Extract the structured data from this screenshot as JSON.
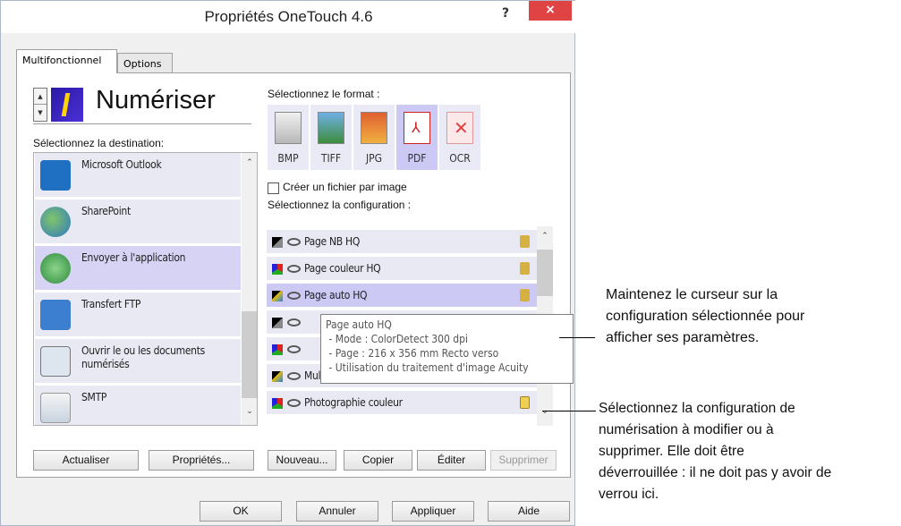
{
  "window": {
    "title": "Propriétés OneTouch 4.6",
    "help": "?",
    "close": "×"
  },
  "tabs": [
    {
      "label": "Multifonctionnel"
    },
    {
      "label": "Options"
    }
  ],
  "scan": {
    "title": "Numériser"
  },
  "destination": {
    "label": "Sélectionnez la destination:",
    "items": [
      {
        "label": "Microsoft Outlook",
        "icon": "outlook-icon"
      },
      {
        "label": "SharePoint",
        "icon": "sharepoint-icon"
      },
      {
        "label": "Envoyer à l'application",
        "icon": "send-app-icon",
        "selected": true
      },
      {
        "label": "Transfert FTP",
        "icon": "ftp-icon"
      },
      {
        "label": "Ouvrir le ou les documents\nnumérisés",
        "icon": "open-docs-icon"
      },
      {
        "label": "SMTP",
        "icon": "mail-icon"
      }
    ]
  },
  "format": {
    "label": "Sélectionnez le format :",
    "items": [
      {
        "label": "BMP",
        "icon": "bmp-icon"
      },
      {
        "label": "TIFF",
        "icon": "tiff-icon"
      },
      {
        "label": "JPG",
        "icon": "jpg-icon"
      },
      {
        "label": "PDF",
        "icon": "pdf-icon",
        "selected": true
      },
      {
        "label": "OCR",
        "icon": "ocr-icon"
      }
    ]
  },
  "one_file_per_image": {
    "label": "Créer un fichier par image",
    "checked": false
  },
  "configuration": {
    "label": "Sélectionnez la configuration :",
    "items": [
      {
        "label": "Page NB HQ"
      },
      {
        "label": "Page couleur HQ"
      },
      {
        "label": "Page auto HQ",
        "selected": true
      },
      {
        "label": ""
      },
      {
        "label": ""
      },
      {
        "label": "Multipaquets auto HQ"
      },
      {
        "label": "Photographie couleur"
      }
    ]
  },
  "tooltip": {
    "line1": "Page auto HQ",
    "line2": " - Mode : ColorDetect 300 dpi",
    "line3": " - Page : 216 x 356 mm Recto verso",
    "line4": " - Utilisation du traitement d'image Acuity"
  },
  "buttons": {
    "refresh": "Actualiser",
    "properties": "Propriétés...",
    "new": "Nouveau...",
    "copy": "Copier",
    "edit": "Éditer",
    "delete": "Supprimer",
    "ok": "OK",
    "cancel": "Annuler",
    "apply": "Appliquer",
    "help": "Aide"
  },
  "callouts": {
    "hover": "Maintenez le curseur sur la\nconfiguration sélectionnée pour\nafficher ses paramètres.",
    "select": "Sélectionnez la configuration de\nnumérisation à modifier ou à\nsupprimer. Elle doit être\ndéverrouillée : il ne doit pas y avoir de\nverrou ici."
  }
}
